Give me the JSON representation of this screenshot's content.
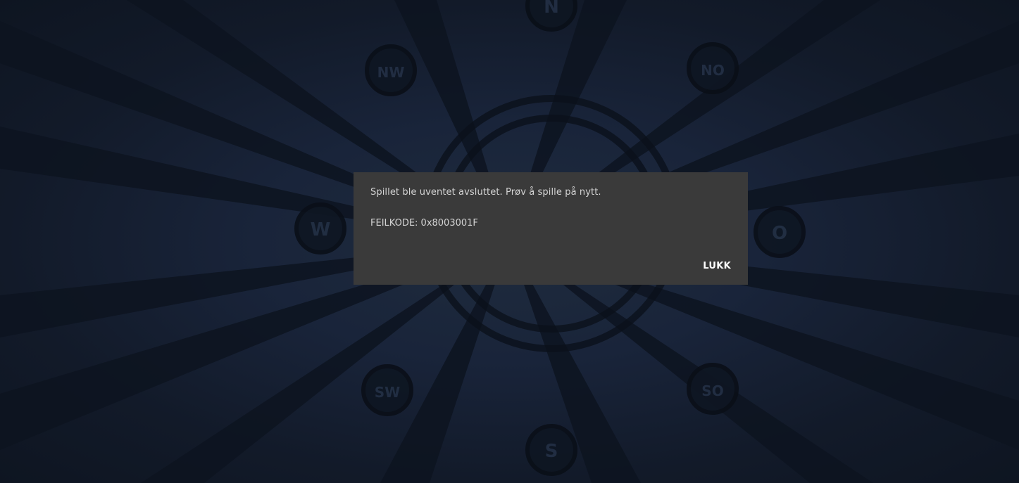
{
  "dialog": {
    "message": "Spillet ble uventet avsluttet. Prøv å spille på nytt.",
    "error_code": "FEILKODE: 0x8003001F",
    "close_label": "LUKK"
  },
  "background": {
    "compass_letters": {
      "north": "N",
      "south": "S",
      "east": "O",
      "west": "W",
      "northeast": "NO",
      "northwest": "NW",
      "southeast": "SO",
      "southwest": "SW"
    }
  },
  "colors": {
    "background": "#121a27",
    "dialog": "#3a3a3a",
    "text": "#d4d4d4",
    "button_text": "#ffffff"
  }
}
